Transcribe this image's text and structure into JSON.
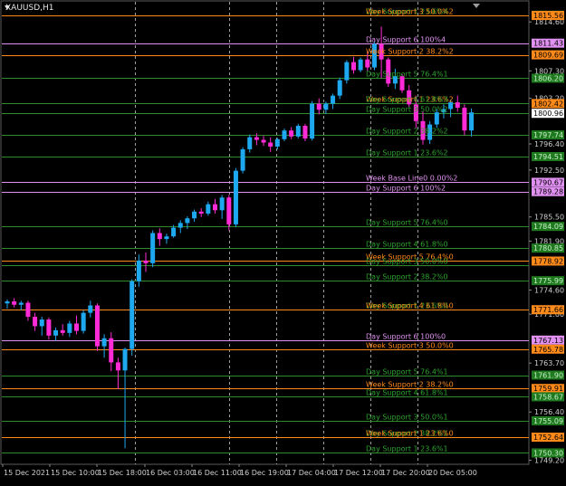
{
  "window": {
    "symbol_title": "XAUUSD,H1"
  },
  "colors": {
    "background": "#000000",
    "bull": "#1ea8f0",
    "bear": "#ff2bd6",
    "day_line": "#2d8a2d",
    "day_label": "#2da32d",
    "week_line": "#ff8a1a",
    "week_label": "#ff8a1a",
    "base_line": "#e090f0",
    "axis_text": "#cfcfcf",
    "grid_vline": "#d0d0d0"
  },
  "x_axis": {
    "labels": [
      "15 Dec 2021",
      "15 Dec 10:00",
      "15 Dec 18:00",
      "16 Dec 03:00",
      "16 Dec 11:00",
      "16 Dec 19:00",
      "17 Dec 04:00",
      "17 Dec 12:00",
      "17 Dec 20:00",
      "20 Dec 05:00"
    ]
  },
  "y_axis": {
    "ticks": [
      "1814.60",
      "1807.30",
      "1803.20",
      "1796.40",
      "1792.50",
      "1785.50",
      "1781.90",
      "1774.60",
      "1771.00",
      "1763.70",
      "1756.40",
      "1749.20"
    ],
    "badges": [
      {
        "value": "1815.60",
        "kind": "day"
      },
      {
        "value": "1815.56",
        "kind": "week"
      },
      {
        "value": "1811.43",
        "kind": "base"
      },
      {
        "value": "1809.69",
        "kind": "week"
      },
      {
        "value": "1806.20",
        "kind": "day"
      },
      {
        "value": "1802.42",
        "kind": "week"
      },
      {
        "value": "1800.96",
        "kind": "price"
      },
      {
        "value": "1797.74",
        "kind": "day"
      },
      {
        "value": "1794.51",
        "kind": "day"
      },
      {
        "value": "1790.67",
        "kind": "base"
      },
      {
        "value": "1789.28",
        "kind": "base"
      },
      {
        "value": "1784.09",
        "kind": "day"
      },
      {
        "value": "1780.85",
        "kind": "day"
      },
      {
        "value": "1778.92",
        "kind": "week"
      },
      {
        "value": "1775.99",
        "kind": "day"
      },
      {
        "value": "1771.66",
        "kind": "week"
      },
      {
        "value": "1767.13",
        "kind": "base"
      },
      {
        "value": "1765.78",
        "kind": "week"
      },
      {
        "value": "1761.90",
        "kind": "day"
      },
      {
        "value": "1759.91",
        "kind": "week"
      },
      {
        "value": "1758.67",
        "kind": "day"
      },
      {
        "value": "1755.09",
        "kind": "day"
      },
      {
        "value": "1752.64",
        "kind": "week"
      },
      {
        "value": "1750.30",
        "kind": "day"
      }
    ]
  },
  "levels": [
    {
      "label": "Day Support 1 23.6%4",
      "kind": "day",
      "price": 1815.6
    },
    {
      "label": "Week Support 3 50.0%2",
      "kind": "week",
      "price": 1815.56
    },
    {
      "label": "Day Support 6 100%4",
      "kind": "base",
      "price": 1811.43
    },
    {
      "label": "Week Support 2 38.2%2",
      "kind": "week",
      "price": 1809.69
    },
    {
      "label": "Day Support 5 76.4%1",
      "kind": "day",
      "price": 1806.2
    },
    {
      "label": "Week Support 1 23.6%2",
      "kind": "week",
      "price": 1802.42
    },
    {
      "label": "Day Support 4 61.8%3",
      "kind": "day",
      "price": 1802.42
    },
    {
      "label": "Day Support 3 50.0%2",
      "kind": "day",
      "price": 1800.96
    },
    {
      "label": "Day Support 2 38.2%2",
      "kind": "day",
      "price": 1797.74
    },
    {
      "label": "Day Support 1 23.6%2",
      "kind": "day",
      "price": 1794.51
    },
    {
      "label": "Week Base Line0 0.00%2",
      "kind": "base",
      "price": 1790.67
    },
    {
      "label": "Day Support 6 100%2",
      "kind": "base",
      "price": 1789.28
    },
    {
      "label": "Day Support 5 76.4%0",
      "kind": "day",
      "price": 1784.09
    },
    {
      "label": "Day Support 4 61.8%0",
      "kind": "day",
      "price": 1780.85
    },
    {
      "label": "Week Support 5 76.4%0",
      "kind": "week",
      "price": 1778.92
    },
    {
      "label": "Day Support 3 50.0%0",
      "kind": "day",
      "price": 1778.3
    },
    {
      "label": "Day Support 2 38.2%0",
      "kind": "day",
      "price": 1775.99
    },
    {
      "label": "Day Support 1 23.6%0",
      "kind": "day",
      "price": 1771.66
    },
    {
      "label": "Week Support 4 61.8%0",
      "kind": "week",
      "price": 1771.66
    },
    {
      "label": "Day Support 6 100%0",
      "kind": "base",
      "price": 1767.13
    },
    {
      "label": "Week Support 3 50.0%0",
      "kind": "week",
      "price": 1765.78
    },
    {
      "label": "Day Support 5 76.4%1",
      "kind": "day",
      "price": 1761.9
    },
    {
      "label": "Week Support 2 38.2%0",
      "kind": "week",
      "price": 1759.91
    },
    {
      "label": "Day Support 4 61.8%1",
      "kind": "day",
      "price": 1758.67
    },
    {
      "label": "Day Support 3 50.0%1",
      "kind": "day",
      "price": 1755.09
    },
    {
      "label": "Day Support 2 38.2%1",
      "kind": "day",
      "price": 1752.64
    },
    {
      "label": "Week Support 1 23.6%0",
      "kind": "week",
      "price": 1752.64
    },
    {
      "label": "Day Support 1 23.6%1",
      "kind": "day",
      "price": 1750.3
    }
  ],
  "chart_data": {
    "type": "candlestick",
    "symbol": "XAUUSD",
    "timeframe": "H1",
    "x_labels": [
      "15 Dec 2021",
      "15 Dec 10:00",
      "15 Dec 18:00",
      "16 Dec 03:00",
      "16 Dec 11:00",
      "16 Dec 19:00",
      "17 Dec 04:00",
      "17 Dec 12:00",
      "17 Dec 20:00",
      "20 Dec 05:00"
    ],
    "ylim": [
      1748.6,
      1817.6
    ],
    "candles": [
      [
        1772.6,
        1773.2,
        1771.8,
        1772.9
      ],
      [
        1772.9,
        1773.4,
        1772.0,
        1772.4
      ],
      [
        1772.4,
        1773.0,
        1771.6,
        1772.7
      ],
      [
        1772.7,
        1773.0,
        1770.0,
        1770.6
      ],
      [
        1770.6,
        1771.2,
        1768.5,
        1769.2
      ],
      [
        1769.2,
        1770.6,
        1767.8,
        1770.2
      ],
      [
        1770.2,
        1770.5,
        1767.2,
        1767.8
      ],
      [
        1767.8,
        1769.0,
        1767.0,
        1768.6
      ],
      [
        1768.6,
        1769.5,
        1767.8,
        1768.2
      ],
      [
        1768.2,
        1770.0,
        1767.6,
        1769.6
      ],
      [
        1769.6,
        1770.8,
        1768.0,
        1768.5
      ],
      [
        1768.5,
        1771.6,
        1768.1,
        1771.2
      ],
      [
        1771.2,
        1773.0,
        1770.5,
        1772.3
      ],
      [
        1772.3,
        1772.6,
        1765.5,
        1766.2
      ],
      [
        1766.2,
        1768.0,
        1764.5,
        1767.4
      ],
      [
        1767.4,
        1768.3,
        1762.5,
        1763.8
      ],
      [
        1763.8,
        1764.5,
        1759.8,
        1762.6
      ],
      [
        1762.6,
        1766.0,
        1751.0,
        1765.8
      ],
      [
        1765.8,
        1776.2,
        1764.8,
        1775.9
      ],
      [
        1775.9,
        1779.9,
        1775.1,
        1779.0
      ],
      [
        1779.0,
        1780.2,
        1777.3,
        1778.6
      ],
      [
        1778.6,
        1783.5,
        1778.0,
        1783.1
      ],
      [
        1783.1,
        1783.8,
        1781.2,
        1782.2
      ],
      [
        1782.2,
        1783.0,
        1781.5,
        1782.6
      ],
      [
        1782.6,
        1784.3,
        1782.4,
        1783.9
      ],
      [
        1783.9,
        1785.0,
        1783.1,
        1784.6
      ],
      [
        1784.6,
        1785.6,
        1783.7,
        1785.3
      ],
      [
        1785.3,
        1786.6,
        1784.8,
        1786.3
      ],
      [
        1786.3,
        1786.8,
        1785.5,
        1786.0
      ],
      [
        1786.0,
        1787.8,
        1785.7,
        1787.4
      ],
      [
        1787.4,
        1788.2,
        1786.0,
        1786.5
      ],
      [
        1786.5,
        1788.8,
        1785.2,
        1788.4
      ],
      [
        1788.4,
        1788.8,
        1783.5,
        1784.4
      ],
      [
        1784.4,
        1792.8,
        1784.0,
        1792.4
      ],
      [
        1792.4,
        1795.9,
        1792.0,
        1795.6
      ],
      [
        1795.6,
        1797.8,
        1795.1,
        1797.4
      ],
      [
        1797.4,
        1798.0,
        1796.2,
        1797.0
      ],
      [
        1797.0,
        1797.6,
        1796.1,
        1796.6
      ],
      [
        1796.6,
        1797.4,
        1795.2,
        1796.0
      ],
      [
        1796.0,
        1797.3,
        1795.6,
        1797.1
      ],
      [
        1797.1,
        1798.7,
        1796.8,
        1798.4
      ],
      [
        1798.4,
        1798.9,
        1797.1,
        1797.5
      ],
      [
        1797.5,
        1799.4,
        1797.2,
        1799.1
      ],
      [
        1799.1,
        1799.4,
        1796.8,
        1797.2
      ],
      [
        1797.2,
        1802.8,
        1796.9,
        1802.4
      ],
      [
        1802.4,
        1803.2,
        1800.8,
        1801.5
      ],
      [
        1801.5,
        1802.7,
        1800.9,
        1802.4
      ],
      [
        1802.4,
        1803.9,
        1801.6,
        1803.6
      ],
      [
        1803.6,
        1806.3,
        1803.1,
        1805.9
      ],
      [
        1805.9,
        1808.9,
        1805.4,
        1808.6
      ],
      [
        1808.6,
        1809.4,
        1806.9,
        1807.4
      ],
      [
        1807.4,
        1809.3,
        1807.1,
        1809.0
      ],
      [
        1809.0,
        1810.2,
        1807.3,
        1807.8
      ],
      [
        1807.8,
        1811.6,
        1807.4,
        1811.3
      ],
      [
        1811.3,
        1813.9,
        1806.2,
        1809.0
      ],
      [
        1809.0,
        1809.3,
        1804.9,
        1805.4
      ],
      [
        1805.4,
        1807.6,
        1804.6,
        1806.5
      ],
      [
        1806.5,
        1806.8,
        1804.0,
        1804.4
      ],
      [
        1804.4,
        1805.2,
        1801.9,
        1802.3
      ],
      [
        1802.3,
        1803.6,
        1798.8,
        1799.8
      ],
      [
        1799.8,
        1801.2,
        1796.3,
        1797.0
      ],
      [
        1797.0,
        1799.8,
        1796.4,
        1799.3
      ],
      [
        1799.3,
        1801.6,
        1798.8,
        1801.1
      ],
      [
        1801.1,
        1802.3,
        1800.2,
        1801.6
      ],
      [
        1801.6,
        1803.0,
        1800.4,
        1802.6
      ],
      [
        1802.6,
        1803.6,
        1801.2,
        1801.8
      ],
      [
        1801.8,
        1802.3,
        1797.7,
        1798.4
      ],
      [
        1798.4,
        1801.7,
        1797.5,
        1801.1
      ]
    ]
  }
}
